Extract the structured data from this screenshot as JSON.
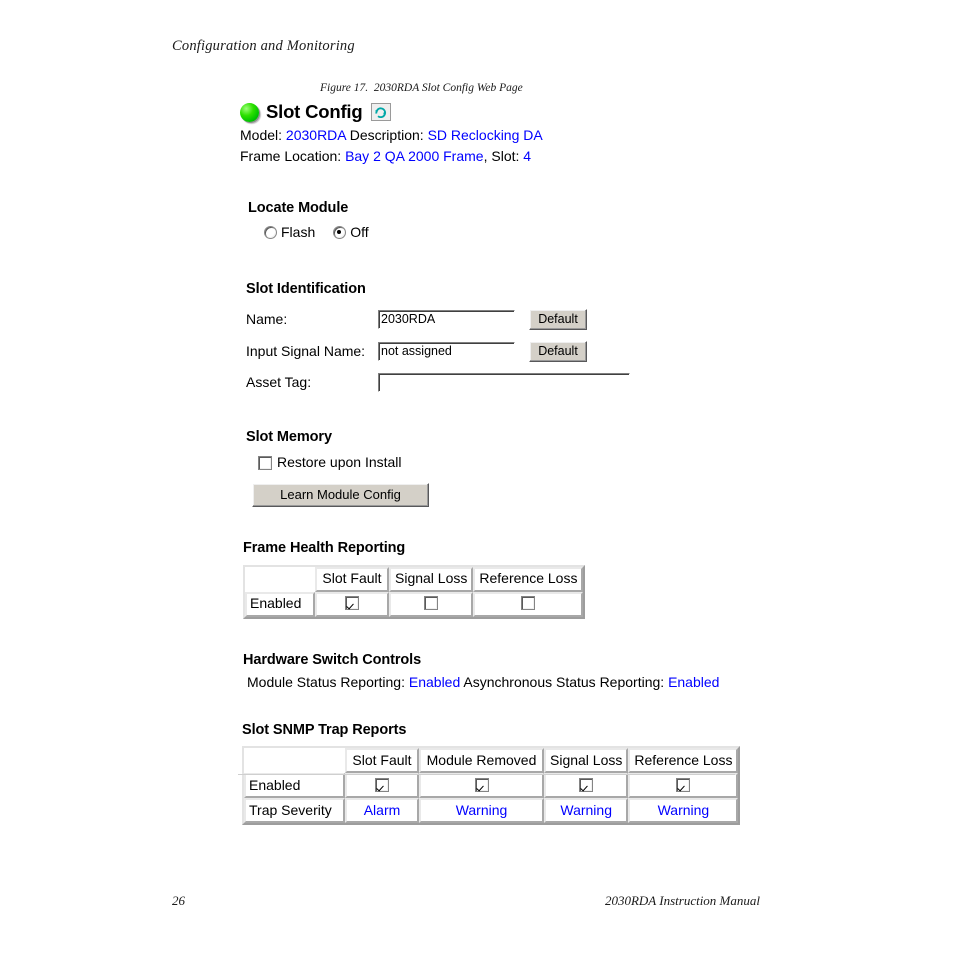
{
  "page": {
    "running_head": "Configuration and Monitoring",
    "figure_caption": "Figure 17.  2030RDA Slot Config Web Page",
    "folio": "26",
    "footer_right": "2030RDA Instruction Manual"
  },
  "webpage": {
    "title": "Slot Config",
    "status_led": "green-led-icon",
    "refresh_icon": "refresh-icon",
    "info": {
      "model_label": "Model:",
      "model_value": "2030RDA",
      "description_label": "Description:",
      "description_value": "SD Reclocking DA",
      "frame_location_label": "Frame Location:",
      "frame_location_value": "Bay 2 QA 2000 Frame",
      "comma": ",",
      "slot_label": "Slot:",
      "slot_value": "4"
    },
    "locate_module": {
      "heading": "Locate Module",
      "options": [
        {
          "label": "Flash",
          "selected": false
        },
        {
          "label": "Off",
          "selected": true
        }
      ]
    },
    "slot_identification": {
      "heading": "Slot Identification",
      "rows": [
        {
          "label": "Name:",
          "value": "2030RDA",
          "placeholder": "",
          "button": "Default"
        },
        {
          "label": "Input Signal Name:",
          "value": "not assigned",
          "placeholder": "",
          "button": "Default"
        },
        {
          "label": "Asset Tag:",
          "value": "",
          "placeholder": "",
          "button": null
        }
      ]
    },
    "slot_memory": {
      "heading": "Slot Memory",
      "restore_label": "Restore upon Install",
      "restore_checked": false,
      "learn_button": "Learn Module Config"
    },
    "frame_health_reporting": {
      "heading": "Frame Health Reporting",
      "columns": [
        "",
        "Slot Fault",
        "Signal Loss",
        "Reference Loss"
      ],
      "rows": [
        {
          "label": "Enabled",
          "checks": [
            true,
            false,
            false
          ]
        }
      ]
    },
    "hardware_switch_controls": {
      "heading": "Hardware Switch Controls",
      "module_status_label": "Module Status Reporting:",
      "module_status_value": "Enabled",
      "async_status_label": "Asynchronous Status Reporting:",
      "async_status_value": "Enabled"
    },
    "slot_snmp_trap_reports": {
      "heading": "Slot SNMP Trap Reports",
      "columns": [
        "",
        "Slot Fault",
        "Module Removed",
        "Signal Loss",
        "Reference Loss"
      ],
      "enabled_row": {
        "label": "Enabled",
        "checks": [
          true,
          true,
          true,
          true
        ]
      },
      "severity_row": {
        "label": "Trap Severity",
        "values": [
          "Alarm",
          "Warning",
          "Warning",
          "Warning"
        ]
      }
    }
  },
  "colors": {
    "link_blue": "#0000FF",
    "led_green": "#2EE000",
    "button_face": "#D4D0C8",
    "refresh_teal": "#00AAAA"
  }
}
